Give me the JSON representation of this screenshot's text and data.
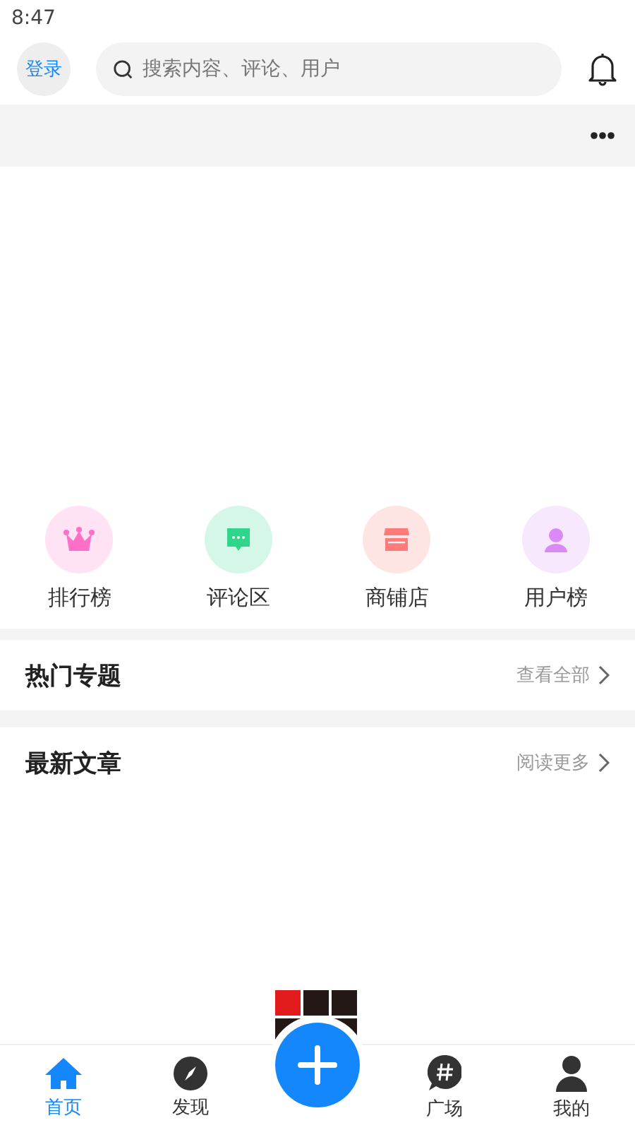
{
  "status_bar": {
    "time": "8:47"
  },
  "header": {
    "login": "登录",
    "search": {
      "placeholder": "搜索内容、评论、用户"
    }
  },
  "shortcuts": [
    {
      "label": "排行榜",
      "color": "#ff6fc8"
    },
    {
      "label": "评论区",
      "color": "#2fd58a"
    },
    {
      "label": "商铺店",
      "color": "#ff7a7a"
    },
    {
      "label": "用户榜",
      "color": "#d98af5"
    }
  ],
  "sections": [
    {
      "title": "热门专题",
      "link": "查看全部"
    },
    {
      "title": "最新文章",
      "link": "阅读更多"
    }
  ],
  "tab_bar": [
    {
      "kind": "tab",
      "label": "首页",
      "selected": true
    },
    {
      "kind": "tab",
      "label": "发现",
      "selected": false
    },
    {
      "kind": "add"
    },
    {
      "kind": "tab",
      "label": "广场",
      "selected": false
    },
    {
      "kind": "tab",
      "label": "我的",
      "selected": false
    }
  ]
}
